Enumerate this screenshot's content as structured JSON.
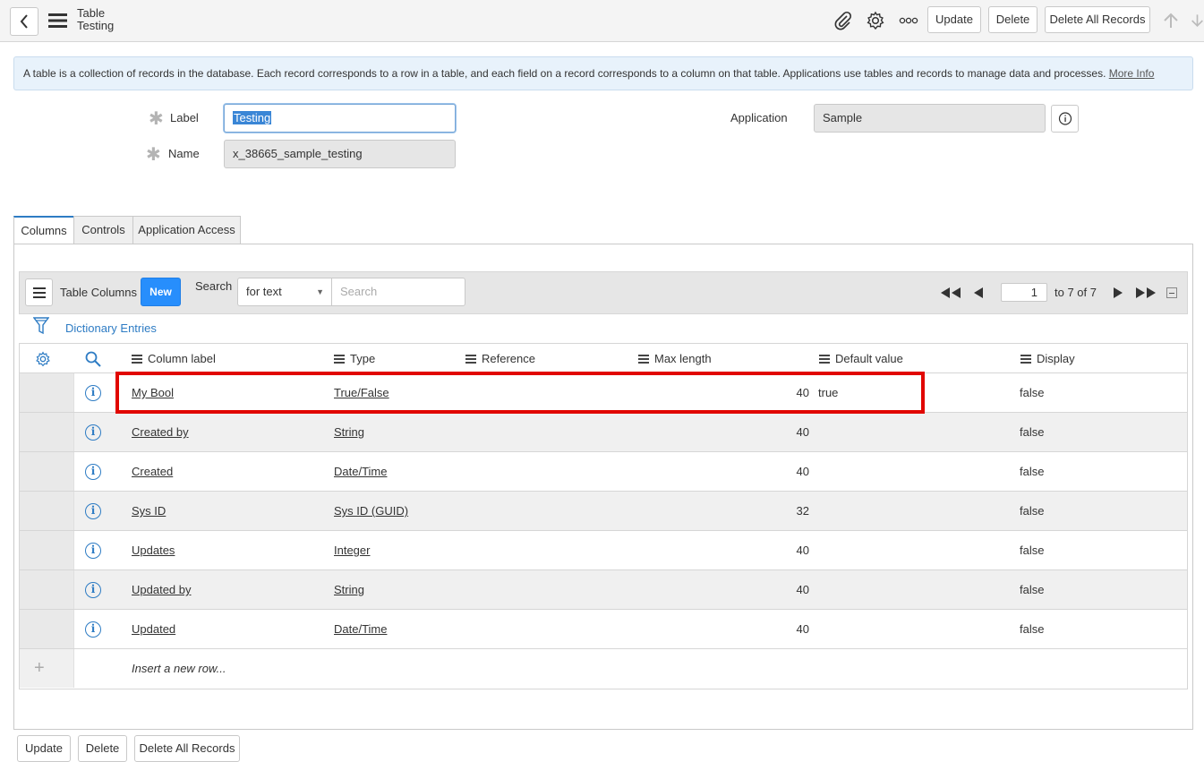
{
  "header": {
    "title": "Table",
    "subtitle": "Testing",
    "update_label": "Update",
    "delete_label": "Delete",
    "delete_all_label": "Delete All Records"
  },
  "banner": {
    "text": "A table is a collection of records in the database. Each record corresponds to a row in a table, and each field on a record corresponds to a column on that table. Applications use tables and records to manage data and processes.",
    "link": "More Info"
  },
  "form": {
    "label_label": "Label",
    "label_value": "Testing",
    "name_label": "Name",
    "name_value": "x_38665_sample_testing",
    "application_label": "Application",
    "application_value": "Sample"
  },
  "tabs": [
    "Columns",
    "Controls",
    "Application Access"
  ],
  "list": {
    "title": "Table Columns",
    "new_label": "New",
    "search_label": "Search",
    "search_mode": "for text",
    "search_placeholder": "Search",
    "page_value": "1",
    "page_range": "to 7 of 7",
    "breadcrumb": "Dictionary Entries"
  },
  "columns": [
    "Column label",
    "Type",
    "Reference",
    "Max length",
    "Default value",
    "Display"
  ],
  "rows": [
    {
      "label": "My Bool",
      "type": "True/False",
      "max": "40",
      "default": "true",
      "display": "false"
    },
    {
      "label": "Created by",
      "type": "String",
      "max": "40",
      "default": "",
      "display": "false"
    },
    {
      "label": "Created",
      "type": "Date/Time",
      "max": "40",
      "default": "",
      "display": "false"
    },
    {
      "label": "Sys ID",
      "type": "Sys ID (GUID)",
      "max": "32",
      "default": "",
      "display": "false"
    },
    {
      "label": "Updates",
      "type": "Integer",
      "max": "40",
      "default": "",
      "display": "false"
    },
    {
      "label": "Updated by",
      "type": "String",
      "max": "40",
      "default": "",
      "display": "false"
    },
    {
      "label": "Updated",
      "type": "Date/Time",
      "max": "40",
      "default": "",
      "display": "false"
    }
  ],
  "insert_row": "Insert a new row...",
  "footer": {
    "update_label": "Update",
    "delete_label": "Delete",
    "delete_all_label": "Delete All Records"
  },
  "colors": {
    "accent": "#2e7cc4",
    "new_button": "#278efc",
    "highlight": "#e10600"
  }
}
